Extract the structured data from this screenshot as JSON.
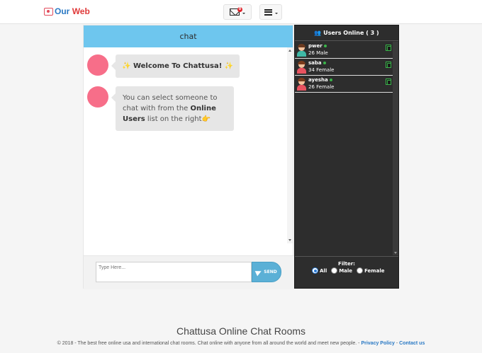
{
  "navbar": {
    "logo_part1": "Our",
    "logo_part2": "Web",
    "mail_badge": "0"
  },
  "chat": {
    "header": "chat",
    "messages": {
      "welcome": {
        "star_left": "✨",
        "text": "Welcome To Chattusa!",
        "star_right": "✨"
      },
      "hint": {
        "pre": "You can select someone to chat with from the ",
        "bold": "Online Users",
        "post": " list on the right",
        "emoji": "👉"
      }
    },
    "input_placeholder": "Type Here...",
    "send_label": "SEND"
  },
  "users": {
    "header": "Users Online ( 3 )",
    "list": [
      {
        "name": "pwer",
        "info": "26 Male",
        "gender": "male"
      },
      {
        "name": "saba",
        "info": "34 Female",
        "gender": "female"
      },
      {
        "name": "ayesha",
        "info": "26 Female",
        "gender": "female"
      }
    ],
    "filter_title": "Filter:",
    "filter_all": "All",
    "filter_male": "Male",
    "filter_female": "Female",
    "filter_selected": "All"
  },
  "footer": {
    "title": "Chattusa Online Chat Rooms",
    "text": "© 2018 - The best free online usa and international chat rooms. Chat online with anyone from all around the world and meet new people. - ",
    "privacy": "Privacy Policy",
    "separator": " - ",
    "contact": "Contact us"
  },
  "colors": {
    "chat_header": "#6ec6ee",
    "avatar": "#f76e89",
    "send_button": "#5bb0d6",
    "users_panel": "#2d2d2d",
    "online_dot": "#3ab44a"
  }
}
